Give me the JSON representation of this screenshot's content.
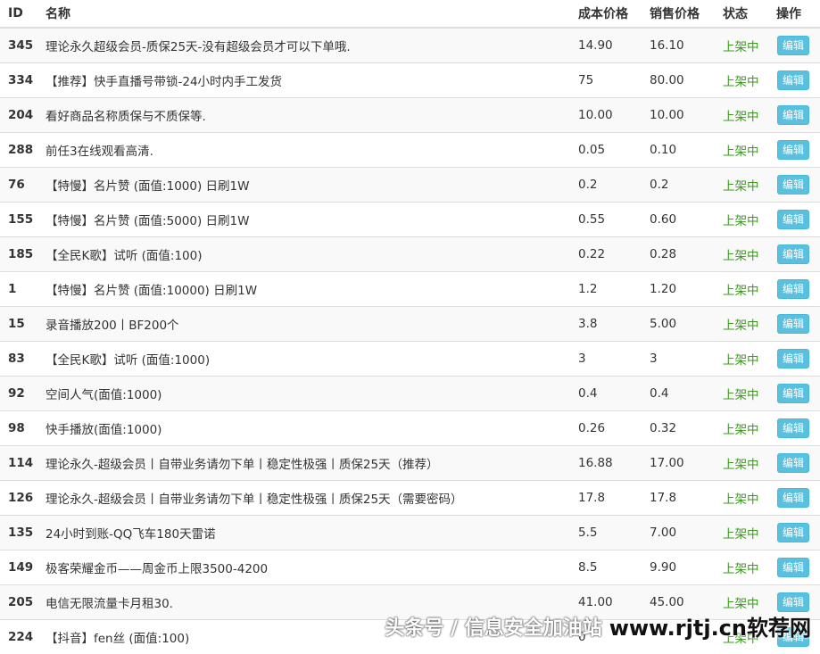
{
  "headers": {
    "id": "ID",
    "name": "名称",
    "cost": "成本价格",
    "sale": "销售价格",
    "status": "状态",
    "op": "操作"
  },
  "rows": [
    {
      "id": "345",
      "name": "理论永久超级会员-质保25天-没有超级会员才可以下单哦.",
      "cost": "14.90",
      "sale": "16.10",
      "status": "上架中",
      "edit": "编辑"
    },
    {
      "id": "334",
      "name": "【推荐】快手直播号带锁-24小时内手工发货",
      "cost": "75",
      "sale": "80.00",
      "status": "上架中",
      "edit": "编辑"
    },
    {
      "id": "204",
      "name": "看好商品名称质保与不质保等.",
      "cost": "10.00",
      "sale": "10.00",
      "status": "上架中",
      "edit": "编辑"
    },
    {
      "id": "288",
      "name": "前任3在线观看高清.",
      "cost": "0.05",
      "sale": "0.10",
      "status": "上架中",
      "edit": "编辑"
    },
    {
      "id": "76",
      "name": "【特慢】名片赞 (面值:1000) 日刷1W",
      "cost": "0.2",
      "sale": "0.2",
      "status": "上架中",
      "edit": "编辑"
    },
    {
      "id": "155",
      "name": "【特慢】名片赞 (面值:5000) 日刷1W",
      "cost": "0.55",
      "sale": "0.60",
      "status": "上架中",
      "edit": "编辑"
    },
    {
      "id": "185",
      "name": "【全民K歌】试听 (面值:100)",
      "cost": "0.22",
      "sale": "0.28",
      "status": "上架中",
      "edit": "编辑"
    },
    {
      "id": "1",
      "name": "【特慢】名片赞 (面值:10000) 日刷1W",
      "cost": "1.2",
      "sale": "1.20",
      "status": "上架中",
      "edit": "编辑"
    },
    {
      "id": "15",
      "name": "录音播放200丨BF200个",
      "cost": "3.8",
      "sale": "5.00",
      "status": "上架中",
      "edit": "编辑"
    },
    {
      "id": "83",
      "name": "【全民K歌】试听 (面值:1000)",
      "cost": "3",
      "sale": "3",
      "status": "上架中",
      "edit": "编辑"
    },
    {
      "id": "92",
      "name": "空间人气(面值:1000)",
      "cost": "0.4",
      "sale": "0.4",
      "status": "上架中",
      "edit": "编辑"
    },
    {
      "id": "98",
      "name": "快手播放(面值:1000)",
      "cost": "0.26",
      "sale": "0.32",
      "status": "上架中",
      "edit": "编辑"
    },
    {
      "id": "114",
      "name": "理论永久-超级会员丨自带业务请勿下单丨稳定性极强丨质保25天（推荐）",
      "cost": "16.88",
      "sale": "17.00",
      "status": "上架中",
      "edit": "编辑"
    },
    {
      "id": "126",
      "name": "理论永久-超级会员丨自带业务请勿下单丨稳定性极强丨质保25天（需要密码）",
      "cost": "17.8",
      "sale": "17.8",
      "status": "上架中",
      "edit": "编辑"
    },
    {
      "id": "135",
      "name": "24小时到账-QQ飞车180天雷诺",
      "cost": "5.5",
      "sale": "7.00",
      "status": "上架中",
      "edit": "编辑"
    },
    {
      "id": "149",
      "name": "极客荣耀金币——周金币上限3500-4200",
      "cost": "8.5",
      "sale": "9.90",
      "status": "上架中",
      "edit": "编辑"
    },
    {
      "id": "205",
      "name": "电信无限流量卡月租30.",
      "cost": "41.00",
      "sale": "45.00",
      "status": "上架中",
      "edit": "编辑"
    },
    {
      "id": "224",
      "name": "【抖音】fen丝 (面值:100)",
      "cost": "0",
      "sale": "",
      "status": "上架中",
      "edit": "编辑"
    }
  ],
  "watermark": {
    "text": "头条号 / 信息安全加油站",
    "site": "www.rjtj.cn软荐网"
  },
  "colors": {
    "status_green": "#3c9a1e",
    "edit_button": "#5bc0de",
    "stripe": "#f9f9f9"
  }
}
